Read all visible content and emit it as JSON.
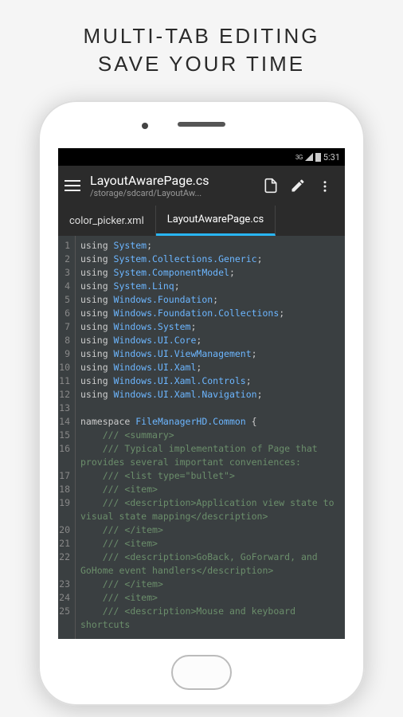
{
  "promo": {
    "line1": "MULTI-TAB EDITING",
    "line2": "SAVE YOUR TIME"
  },
  "statusbar": {
    "network": "3G",
    "time": "5:31"
  },
  "appbar": {
    "title": "LayoutAwarePage.cs",
    "subtitle": "/storage/sdcard/LayoutAw..."
  },
  "tabs": [
    {
      "label": "color_picker.xml",
      "active": false
    },
    {
      "label": "LayoutAwarePage.cs",
      "active": true
    }
  ],
  "code_lines": [
    {
      "n": 1,
      "segs": [
        [
          "k",
          "using "
        ],
        [
          "t",
          "System"
        ],
        [
          "k",
          ";"
        ]
      ]
    },
    {
      "n": 2,
      "segs": [
        [
          "k",
          "using "
        ],
        [
          "t",
          "System.Collections.Generic"
        ],
        [
          "k",
          ";"
        ]
      ]
    },
    {
      "n": 3,
      "segs": [
        [
          "k",
          "using "
        ],
        [
          "t",
          "System.ComponentModel"
        ],
        [
          "k",
          ";"
        ]
      ]
    },
    {
      "n": 4,
      "segs": [
        [
          "k",
          "using "
        ],
        [
          "t",
          "System.Linq"
        ],
        [
          "k",
          ";"
        ]
      ]
    },
    {
      "n": 5,
      "segs": [
        [
          "k",
          "using "
        ],
        [
          "t",
          "Windows.Foundation"
        ],
        [
          "k",
          ";"
        ]
      ]
    },
    {
      "n": 6,
      "segs": [
        [
          "k",
          "using "
        ],
        [
          "t",
          "Windows.Foundation.Collections"
        ],
        [
          "k",
          ";"
        ]
      ]
    },
    {
      "n": 7,
      "segs": [
        [
          "k",
          "using "
        ],
        [
          "t",
          "Windows.System"
        ],
        [
          "k",
          ";"
        ]
      ]
    },
    {
      "n": 8,
      "segs": [
        [
          "k",
          "using "
        ],
        [
          "t",
          "Windows.UI.Core"
        ],
        [
          "k",
          ";"
        ]
      ]
    },
    {
      "n": 9,
      "segs": [
        [
          "k",
          "using "
        ],
        [
          "t",
          "Windows.UI.ViewManagement"
        ],
        [
          "k",
          ";"
        ]
      ]
    },
    {
      "n": 10,
      "segs": [
        [
          "k",
          "using "
        ],
        [
          "t",
          "Windows.UI.Xaml"
        ],
        [
          "k",
          ";"
        ]
      ]
    },
    {
      "n": 11,
      "segs": [
        [
          "k",
          "using "
        ],
        [
          "t",
          "Windows.UI.Xaml.Controls"
        ],
        [
          "k",
          ";"
        ]
      ]
    },
    {
      "n": 12,
      "segs": [
        [
          "k",
          "using "
        ],
        [
          "t",
          "Windows.UI.Xaml.Navigation"
        ],
        [
          "k",
          ";"
        ]
      ]
    },
    {
      "n": 13,
      "segs": []
    },
    {
      "n": 14,
      "segs": [
        [
          "k",
          "namespace "
        ],
        [
          "t",
          "FileManagerHD.Common"
        ],
        [
          "k",
          " {"
        ]
      ]
    },
    {
      "n": 15,
      "segs": [
        [
          "c",
          "    /// <summary>"
        ]
      ]
    },
    {
      "n": 16,
      "segs": [
        [
          "c",
          "    /// Typical implementation of Page that provides several important conveniences:"
        ]
      ]
    },
    {
      "n": 17,
      "segs": [
        [
          "c",
          "    /// <list type=\"bullet\">"
        ]
      ]
    },
    {
      "n": 18,
      "segs": [
        [
          "c",
          "    /// <item>"
        ]
      ]
    },
    {
      "n": 19,
      "segs": [
        [
          "c",
          "    /// <description>Application view state to visual state mapping</description>"
        ]
      ]
    },
    {
      "n": 20,
      "segs": [
        [
          "c",
          "    /// </item>"
        ]
      ]
    },
    {
      "n": 21,
      "segs": [
        [
          "c",
          "    /// <item>"
        ]
      ]
    },
    {
      "n": 22,
      "segs": [
        [
          "c",
          "    /// <description>GoBack, GoForward, and GoHome event handlers</description>"
        ]
      ]
    },
    {
      "n": 23,
      "segs": [
        [
          "c",
          "    /// </item>"
        ]
      ]
    },
    {
      "n": 24,
      "segs": [
        [
          "c",
          "    /// <item>"
        ]
      ]
    },
    {
      "n": 25,
      "segs": [
        [
          "c",
          "    /// <description>Mouse and keyboard shortcuts"
        ]
      ]
    }
  ]
}
